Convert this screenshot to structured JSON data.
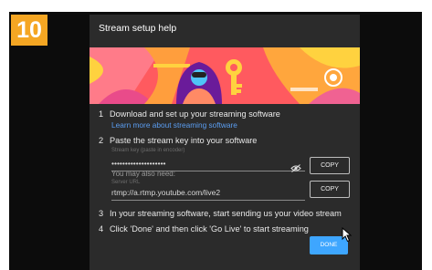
{
  "step_badge": "10",
  "dialog": {
    "title": "Stream setup help",
    "steps": [
      {
        "num": "1",
        "text": "Download and set up your streaming software",
        "link": "Learn more about streaming software"
      },
      {
        "num": "2",
        "text": "Paste the stream key into your software"
      },
      {
        "num": "3",
        "text": "In your streaming software, start sending us your video stream"
      },
      {
        "num": "4",
        "text": "Click 'Done' and then click 'Go Live' to start streaming"
      }
    ],
    "stream_key": {
      "label": "Stream key (paste in encoder)",
      "value": "••••••••••••••••••••",
      "copy_label": "COPY"
    },
    "also_need": "You may also need:",
    "server_url": {
      "label": "Server URL",
      "value": "rtmp://a.rtmp.youtube.com/live2",
      "copy_label": "COPY"
    },
    "done_label": "DONE"
  },
  "colors": {
    "accent": "#3ea6ff",
    "badge": "#f5a623",
    "dialog_bg": "#2b2b2b"
  },
  "icons": [
    "eye-off-icon",
    "mouse-cursor-icon"
  ]
}
